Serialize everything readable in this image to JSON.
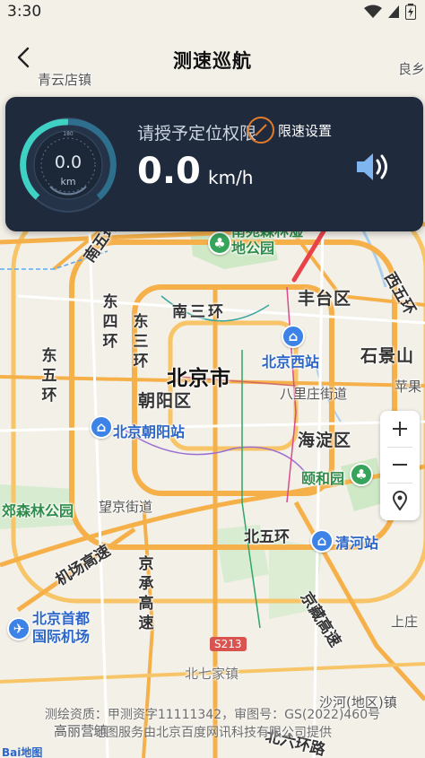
{
  "status_bar": {
    "time": "3:30"
  },
  "header": {
    "title": "测速巡航"
  },
  "speed_panel": {
    "gauge_value": "0.0",
    "gauge_unit": "km",
    "gauge_top": "180",
    "permission_text": "请授予定位权限",
    "speed_limit_label": "限速设置",
    "speed_value": "0.0",
    "speed_unit": "km/h"
  },
  "map": {
    "labels": {
      "qingyundian": "青云店镇",
      "liangxiang": "良乡",
      "nanwuhuan": "南五环",
      "nanyuan_park": "南苑森林湿地公园",
      "nansanhuan": "南三环",
      "fengtai": "丰台区",
      "xiwuhuan": "西五环",
      "dongsihuan": "东四环",
      "dongsanhuan": "东三环",
      "dongwuhuan": "东五环",
      "beijing_west": "北京西站",
      "shijingshan": "石景山",
      "beijing_city": "北京市",
      "chaoyang": "朝阳区",
      "balizhuang": "八里庄街道",
      "pingguo": "苹果",
      "beijing_chaoyang_station": "北京朝阳站",
      "haidian": "海淀区",
      "yiheyuan": "颐和园",
      "forest_park": "郊森林公园",
      "wangjing": "望京街道",
      "beiwuhuan": "北五环",
      "qinghe": "清河站",
      "jichang": "机场高速",
      "jingcheng": "京承高速",
      "jingzang": "京藏高速",
      "capital_airport": "北京首都国际机场",
      "shangzhuang": "上庄",
      "s213": "S213",
      "beiqijia": "北七家镇",
      "shahe": "沙河(地区)镇",
      "beiliuhuan": "北六环路",
      "gaoliying": "高丽营镇"
    }
  },
  "footer": {
    "line1": "测绘资质：甲测资字11111342，审图号：GS(2022)460号",
    "line2": "地图服务由北京百度网讯科技有限公司提供",
    "logo": "Bai地图"
  },
  "colors": {
    "panel": "#1f2a3d",
    "accent": "#e07b2b",
    "gauge": "#3fd1c4",
    "arrow": "#e8434a"
  }
}
